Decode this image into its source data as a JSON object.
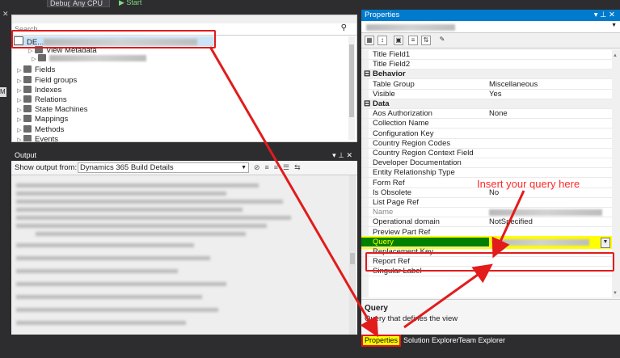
{
  "toolbar": {
    "config": "Debug",
    "platform": "Any CPU",
    "start": "▶ Start"
  },
  "solution": {
    "search_placeholder": "Search ...",
    "root_label": "DE...",
    "nodes": [
      {
        "label": "View Metadata",
        "indent": 1
      },
      {
        "label": "Fields",
        "indent": 0
      },
      {
        "label": "Field groups",
        "indent": 0
      },
      {
        "label": "Indexes",
        "indent": 0
      },
      {
        "label": "Relations",
        "indent": 0
      },
      {
        "label": "State Machines",
        "indent": 0
      },
      {
        "label": "Mappings",
        "indent": 0
      },
      {
        "label": "Methods",
        "indent": 0
      },
      {
        "label": "Events",
        "indent": 0
      }
    ]
  },
  "output": {
    "title": "Output",
    "show_from_label": "Show output from:",
    "show_from_value": "Dynamics 365 Build Details"
  },
  "properties": {
    "title": "Properties",
    "rows": [
      {
        "name": "Title Field1",
        "value": "",
        "kind": "prop"
      },
      {
        "name": "Title Field2",
        "value": "",
        "kind": "prop"
      },
      {
        "name": "Behavior",
        "value": "",
        "kind": "cat"
      },
      {
        "name": "Table Group",
        "value": "Miscellaneous",
        "kind": "prop"
      },
      {
        "name": "Visible",
        "value": "Yes",
        "kind": "prop"
      },
      {
        "name": "Data",
        "value": "",
        "kind": "cat"
      },
      {
        "name": "Aos Authorization",
        "value": "None",
        "kind": "prop"
      },
      {
        "name": "Collection Name",
        "value": "",
        "kind": "prop"
      },
      {
        "name": "Configuration Key",
        "value": "",
        "kind": "prop"
      },
      {
        "name": "Country Region Codes",
        "value": "",
        "kind": "prop"
      },
      {
        "name": "Country Region Context Field",
        "value": "",
        "kind": "prop"
      },
      {
        "name": "Developer Documentation",
        "value": "",
        "kind": "prop"
      },
      {
        "name": "Entity Relationship Type",
        "value": "",
        "kind": "prop"
      },
      {
        "name": "Form Ref",
        "value": "",
        "kind": "prop"
      },
      {
        "name": "Is Obsolete",
        "value": "No",
        "kind": "prop"
      },
      {
        "name": "List Page Ref",
        "value": "",
        "kind": "prop"
      },
      {
        "name": "Name",
        "value": "",
        "kind": "prop"
      },
      {
        "name": "Operational domain",
        "value": "NotSpecified",
        "kind": "prop"
      },
      {
        "name": "Preview Part Ref",
        "value": "",
        "kind": "prop"
      },
      {
        "name": "Query",
        "value": "",
        "kind": "selected"
      },
      {
        "name": "Replacement Key",
        "value": "",
        "kind": "prop"
      },
      {
        "name": "Report Ref",
        "value": "",
        "kind": "prop"
      },
      {
        "name": "Singular Label",
        "value": "",
        "kind": "prop"
      }
    ],
    "desc_title": "Query",
    "desc_text": "Query that defines the view"
  },
  "tabs": [
    "Properties",
    "Solution Explorer",
    "Team Explorer"
  ],
  "annotation": {
    "text": "Insert your query here"
  },
  "colors": {
    "accent": "#007acc",
    "highlight": "#e21b1b",
    "selected": "#008000",
    "callout_fill": "#ffff00"
  }
}
